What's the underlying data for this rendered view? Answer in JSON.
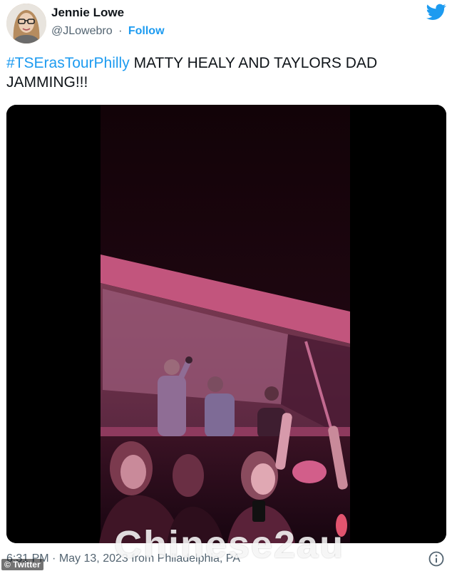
{
  "author": {
    "display_name": "Jennie Lowe",
    "handle": "@JLowebro",
    "follow_label": "Follow",
    "separator": "·"
  },
  "tweet": {
    "hashtag": "#TSErasTourPhilly",
    "text": " MATTY HEALY AND TAYLORS DAD JAMMING!!!"
  },
  "meta": {
    "time": "6:31 PM",
    "date": "May 13, 2023",
    "location": "from Philadelphia, PA"
  },
  "overlay": {
    "watermark": "Chinese2au",
    "credit": "© Twitter"
  },
  "icons": {
    "brand": "twitter-bird-icon",
    "info": "info-icon"
  },
  "colors": {
    "accent": "#1d9bf0",
    "text": "#0f1419",
    "secondary": "#536471"
  }
}
